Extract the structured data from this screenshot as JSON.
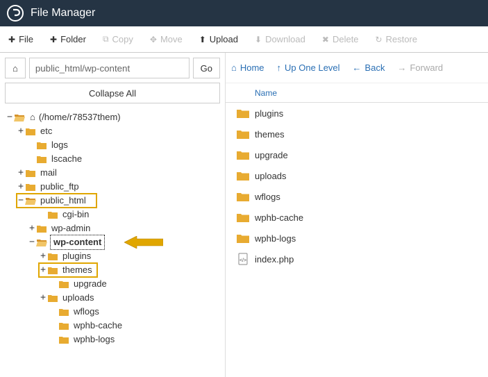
{
  "app": {
    "title": "File Manager"
  },
  "toolbar": {
    "file": "File",
    "folder": "Folder",
    "copy": "Copy",
    "move": "Move",
    "upload": "Upload",
    "download": "Download",
    "delete": "Delete",
    "restore": "Restore"
  },
  "left": {
    "path": "public_html/wp-content",
    "go": "Go",
    "collapse": "Collapse All"
  },
  "tree": {
    "root": "(/home/r78537them)",
    "etc": "etc",
    "logs": "logs",
    "lscache": "lscache",
    "mail": "mail",
    "public_ftp": "public_ftp",
    "public_html": "public_html",
    "cgi_bin": "cgi-bin",
    "wp_admin": "wp-admin",
    "wp_content": "wp-content",
    "plugins": "plugins",
    "themes": "themes",
    "upgrade": "upgrade",
    "uploads": "uploads",
    "wflogs": "wflogs",
    "wphb_cache": "wphb-cache",
    "wphb_logs": "wphb-logs"
  },
  "nav": {
    "home": "Home",
    "up": "Up One Level",
    "back": "Back",
    "forward": "Forward"
  },
  "listhead": {
    "name": "Name"
  },
  "files": [
    {
      "name": "plugins",
      "type": "folder"
    },
    {
      "name": "themes",
      "type": "folder"
    },
    {
      "name": "upgrade",
      "type": "folder"
    },
    {
      "name": "uploads",
      "type": "folder"
    },
    {
      "name": "wflogs",
      "type": "folder"
    },
    {
      "name": "wphb-cache",
      "type": "folder"
    },
    {
      "name": "wphb-logs",
      "type": "folder"
    },
    {
      "name": "index.php",
      "type": "file"
    }
  ],
  "colors": {
    "folder_closed": "#e8ab31",
    "folder_open": "#e8ab31",
    "link": "#2a6fb4",
    "highlight_border": "#e0a600",
    "arrow": "#e0a600"
  }
}
